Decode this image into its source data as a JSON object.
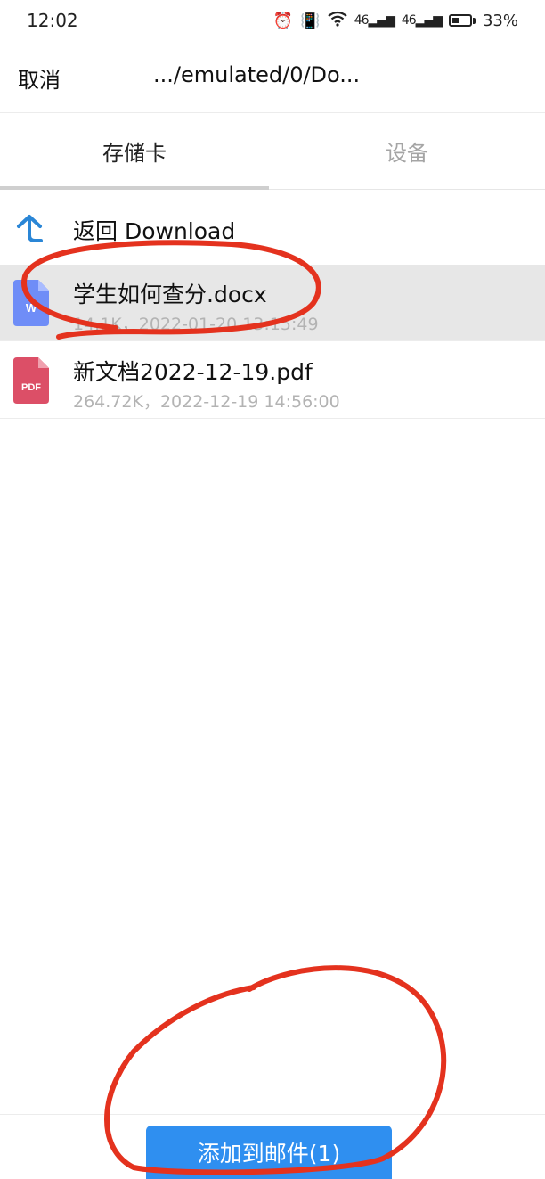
{
  "status": {
    "time": "12:02",
    "signal1": "46",
    "signal2": "46",
    "battery": "33%"
  },
  "topbar": {
    "cancel": "取消",
    "path": ".../emulated/0/Do..."
  },
  "tabs": [
    {
      "label": "存储卡",
      "active": true
    },
    {
      "label": "设备",
      "active": false
    }
  ],
  "back": {
    "label": "返回 Download"
  },
  "files": [
    {
      "name": "学生如何查分.docx",
      "meta": "14.1K，2022-01-20 13:15:49",
      "icon": "word-doc-icon",
      "selected": true,
      "icon_text": "W",
      "color": "#6f8df7"
    },
    {
      "name": "新文档2022-12-19.pdf",
      "meta": "264.72K，2022-12-19 14:56:00",
      "icon": "pdf-icon",
      "selected": false,
      "icon_text": "PDF",
      "color": "#dc4f67"
    }
  ],
  "bottom": {
    "button_label": "添加到邮件(1)"
  },
  "colors": {
    "accent": "#2f8ff0",
    "annotation": "#e4321e"
  }
}
